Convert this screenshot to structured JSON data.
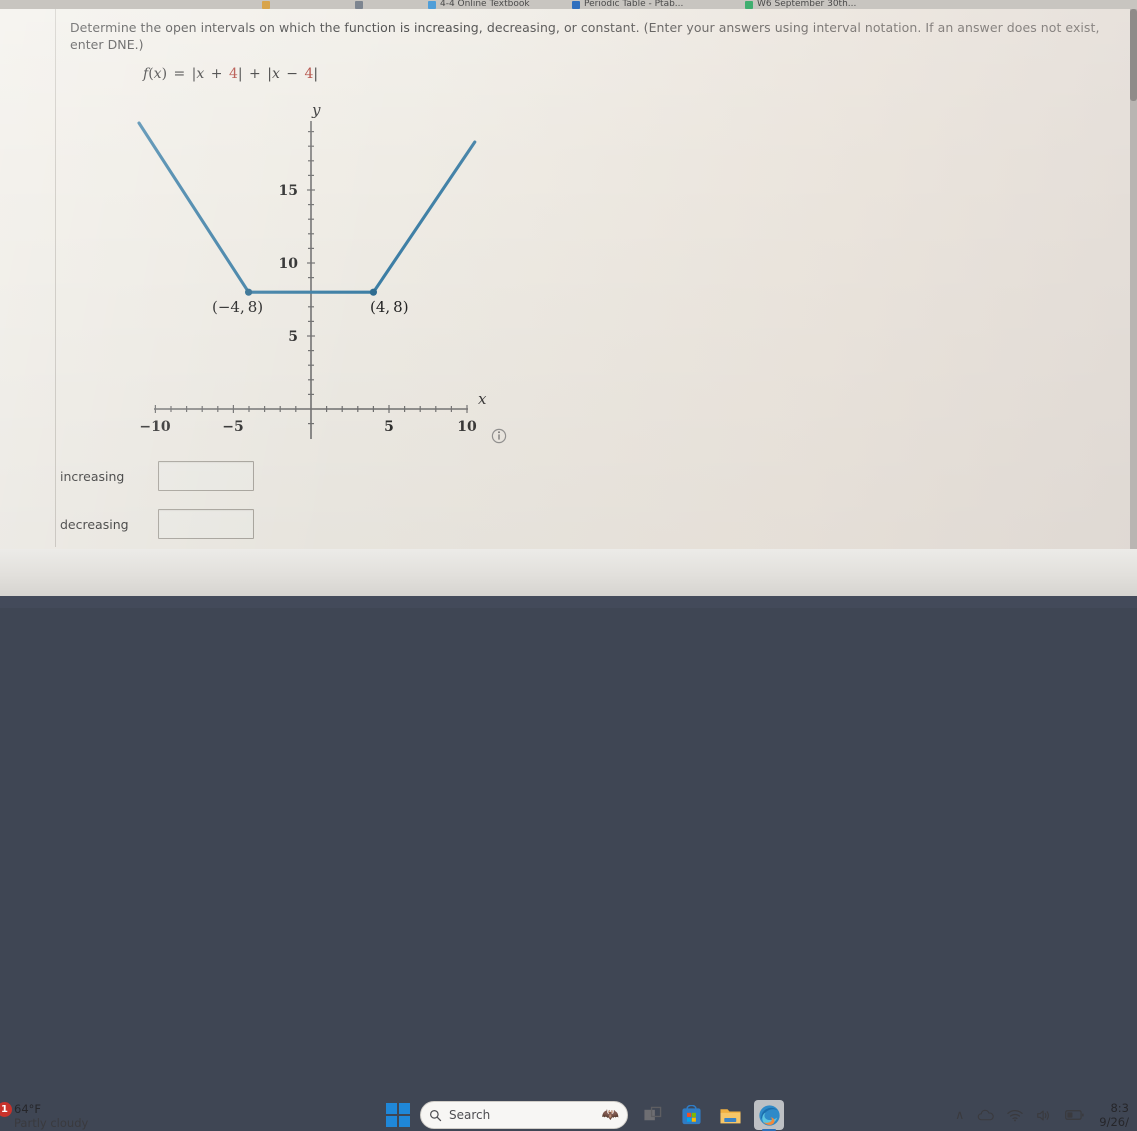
{
  "browser": {
    "tabs": [
      {
        "label": "",
        "color": "#d8a44a"
      },
      {
        "label": "",
        "color": "#7d8590"
      },
      {
        "label": "4-4 Online Textbook",
        "color": "#4f9ed8"
      },
      {
        "label": "Periodic Table - Ptab...",
        "color": "#2f6fbe"
      },
      {
        "label": "W6 September 30th...",
        "color": "#3fae6f"
      }
    ]
  },
  "question": {
    "prompt": "Determine the open intervals on which the function is increasing, decreasing, or constant. (Enter your answers using interval notation. If an answer does not exist, enter DNE.)",
    "formula_parts": [
      {
        "t": "f",
        "k": "v"
      },
      {
        "t": "(",
        "k": ""
      },
      {
        "t": "x",
        "k": "v"
      },
      {
        "t": ")",
        "k": ""
      },
      {
        "t": " = ",
        "k": "op"
      },
      {
        "t": "|",
        "k": ""
      },
      {
        "t": "x",
        "k": "v"
      },
      {
        "t": " + ",
        "k": "op"
      },
      {
        "t": "4",
        "k": "num"
      },
      {
        "t": "|",
        "k": ""
      },
      {
        "t": " + ",
        "k": "op"
      },
      {
        "t": "|",
        "k": ""
      },
      {
        "t": "x",
        "k": "v"
      },
      {
        "t": " − ",
        "k": "op"
      },
      {
        "t": "4",
        "k": "num"
      },
      {
        "t": "|",
        "k": ""
      }
    ],
    "formula_plain": "f(x) = |x + 4| + |x − 4|"
  },
  "answers": {
    "increasing": {
      "label": "increasing",
      "value": "",
      "placeholder": ""
    },
    "decreasing": {
      "label": "decreasing",
      "value": "",
      "placeholder": ""
    }
  },
  "chart_data": {
    "type": "line",
    "title": "",
    "xlabel": "x",
    "ylabel": "y",
    "xlim": [
      -11.5,
      11.5
    ],
    "ylim": [
      -2.5,
      19
    ],
    "grid": false,
    "legend": false,
    "line_color": "#3d7fa6",
    "axis_color": "#6b6b6b",
    "x_ticks_labeled": [
      -10,
      -5,
      5,
      10
    ],
    "x_tick_labels": [
      "−10",
      "−5",
      "5",
      "10"
    ],
    "x_minor_tick_step": 1,
    "y_ticks_labeled": [
      5,
      10,
      15
    ],
    "y_tick_labels": [
      "5",
      "10",
      "15"
    ],
    "y_minor_tick_step": 1,
    "series": [
      {
        "name": "f(x) = |x + 4| + |x - 4|",
        "x": [
          -11.0,
          -4,
          4,
          10.5
        ],
        "y": [
          22,
          8,
          8,
          21
        ]
      }
    ],
    "points": [
      {
        "x": -4,
        "y": 8,
        "label": "(−4, 8)",
        "label_pos": "below-left"
      },
      {
        "x": 4,
        "y": 8,
        "label": "(4, 8)",
        "label_pos": "below-right"
      }
    ],
    "annotations": [
      {
        "name": "info-icon",
        "glyph": "ⓘ"
      }
    ]
  },
  "taskbar": {
    "weather": {
      "temp": "64°F",
      "condition": "Partly cloudy",
      "badge": "1"
    },
    "start_label": "Start",
    "search": {
      "placeholder": "Search",
      "value": "Search"
    },
    "apps": [
      {
        "name": "task-view",
        "label": "Task View",
        "active": false
      },
      {
        "name": "microsoft-store",
        "label": "Microsoft Store",
        "active": false
      },
      {
        "name": "file-explorer",
        "label": "File Explorer",
        "active": false
      },
      {
        "name": "microsoft-edge",
        "label": "Microsoft Edge",
        "active": true
      }
    ],
    "tray": {
      "chevron": "∧",
      "cloud": "cloud-icon",
      "wifi": "wifi-icon",
      "volume": "volume-icon",
      "battery": "battery-icon"
    },
    "clock": {
      "time": "8:3",
      "date": "9/26/"
    }
  }
}
